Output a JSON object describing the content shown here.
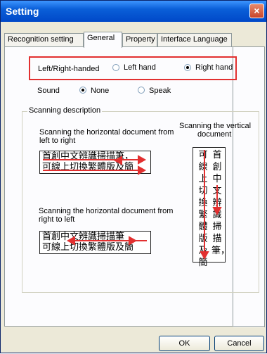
{
  "window": {
    "title": "Setting",
    "close_icon": "×"
  },
  "tabs": [
    {
      "label": "Recognition setting"
    },
    {
      "label": "General"
    },
    {
      "label": "Property"
    },
    {
      "label": "Interface Language"
    }
  ],
  "hand": {
    "label": "Left/Right-handed",
    "left_label": "Left hand",
    "right_label": "Right hand",
    "selected": "Right hand"
  },
  "sound": {
    "label": "Sound",
    "none_label": "None",
    "speak_label": "Speak",
    "selected": "None"
  },
  "scanning": {
    "group_title": "Scanning description",
    "ltr_caption_1": "Scanning the horizontal document from",
    "ltr_caption_2": "left to right",
    "rtl_caption_1": "Scanning the horizontal document from",
    "rtl_caption_2": "right to left",
    "vert_caption_1": "Scanning the vertical",
    "vert_caption_2": "document",
    "ltr_line1": "首創中文辨識掃描筆，",
    "ltr_line2": "可線上切換繁體版及簡",
    "rtl_line1": "首創中文辨識掃描筆",
    "rtl_line2": "可線上切換繁體版及簡",
    "vert_col_right": "首創中文辨識掃描筆，",
    "vert_col_left": "可線上切換繁體版及簡"
  },
  "buttons": {
    "ok": "OK",
    "cancel": "Cancel"
  },
  "colors": {
    "highlight": "#e23030",
    "titlebar": "#0048c8"
  }
}
